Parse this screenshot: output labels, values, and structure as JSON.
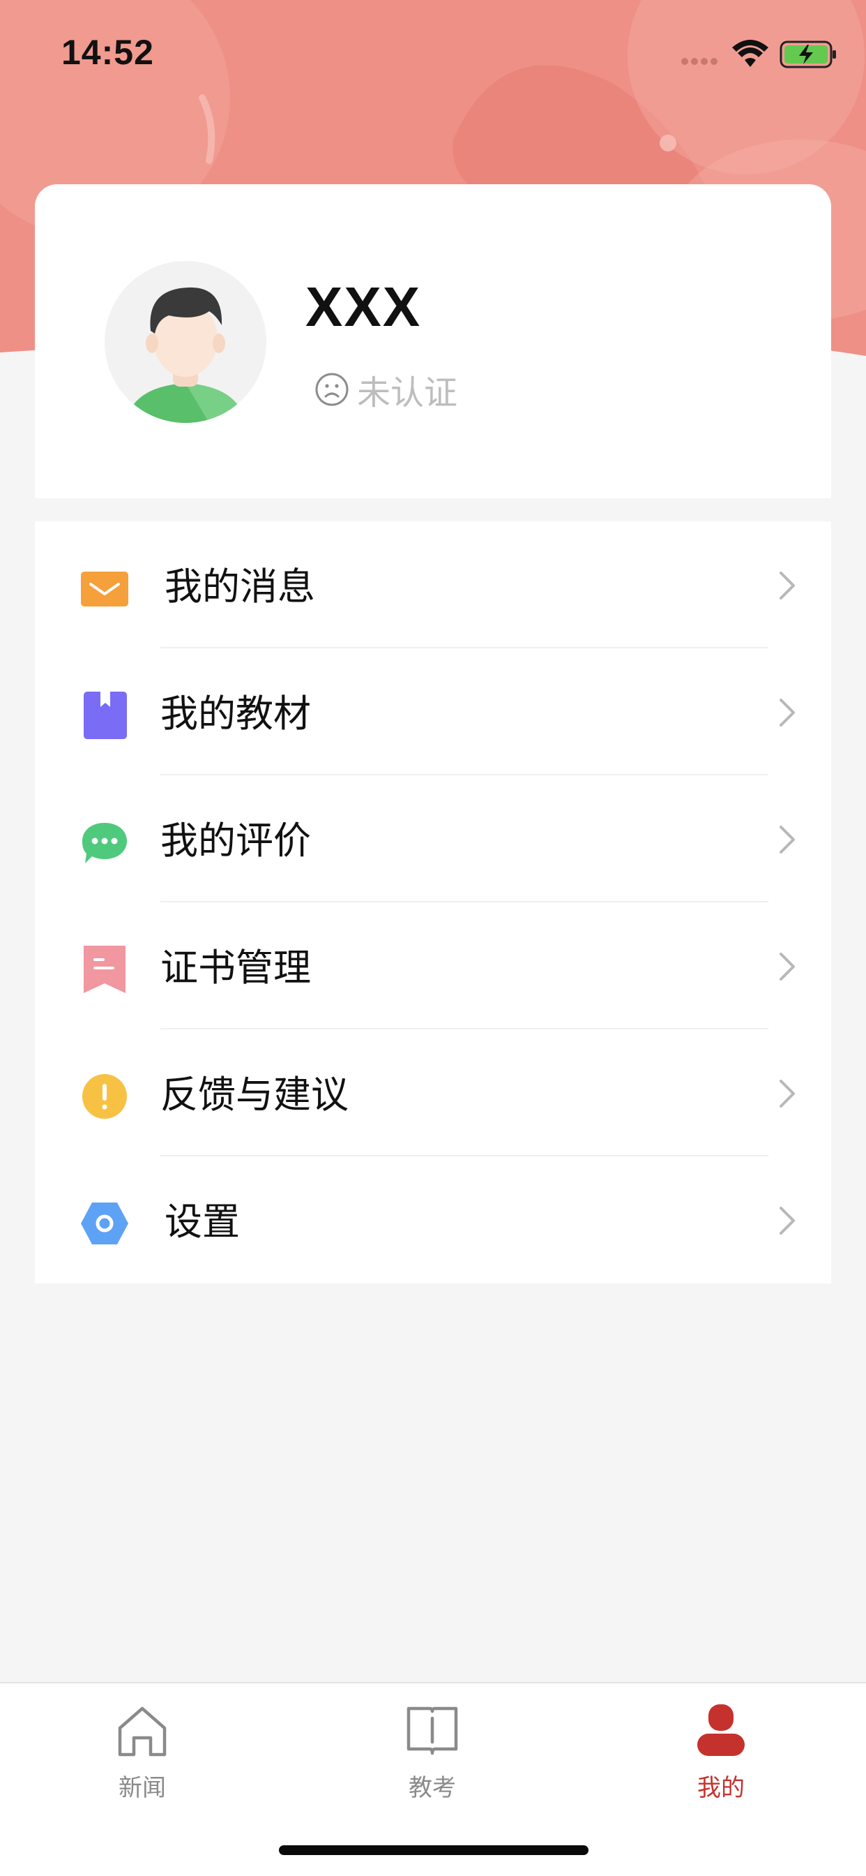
{
  "status_bar": {
    "time": "14:52"
  },
  "profile": {
    "name": "XXX",
    "verify_status": "未认证"
  },
  "menu": {
    "items": [
      {
        "label": "我的消息",
        "icon": "mail-icon",
        "color": "#f5a03a"
      },
      {
        "label": "我的教材",
        "icon": "bookmark-book-icon",
        "color": "#7b6cf6"
      },
      {
        "label": "我的评价",
        "icon": "chat-bubble-icon",
        "color": "#4fc97c"
      },
      {
        "label": "证书管理",
        "icon": "certificate-ribbon-icon",
        "color": "#f0979f"
      },
      {
        "label": "反馈与建议",
        "icon": "exclamation-icon",
        "color": "#f7c244"
      },
      {
        "label": "设置",
        "icon": "hexagon-gear-icon",
        "color": "#5ea2f6"
      }
    ]
  },
  "tab_bar": {
    "tabs": [
      {
        "label": "新闻",
        "icon": "home-icon",
        "active": false
      },
      {
        "label": "教考",
        "icon": "book-icon",
        "active": false
      },
      {
        "label": "我的",
        "icon": "person-icon",
        "active": true
      }
    ]
  },
  "colors": {
    "header": "#ee8a80",
    "accent": "#c5322e",
    "background": "#f5f5f5"
  }
}
